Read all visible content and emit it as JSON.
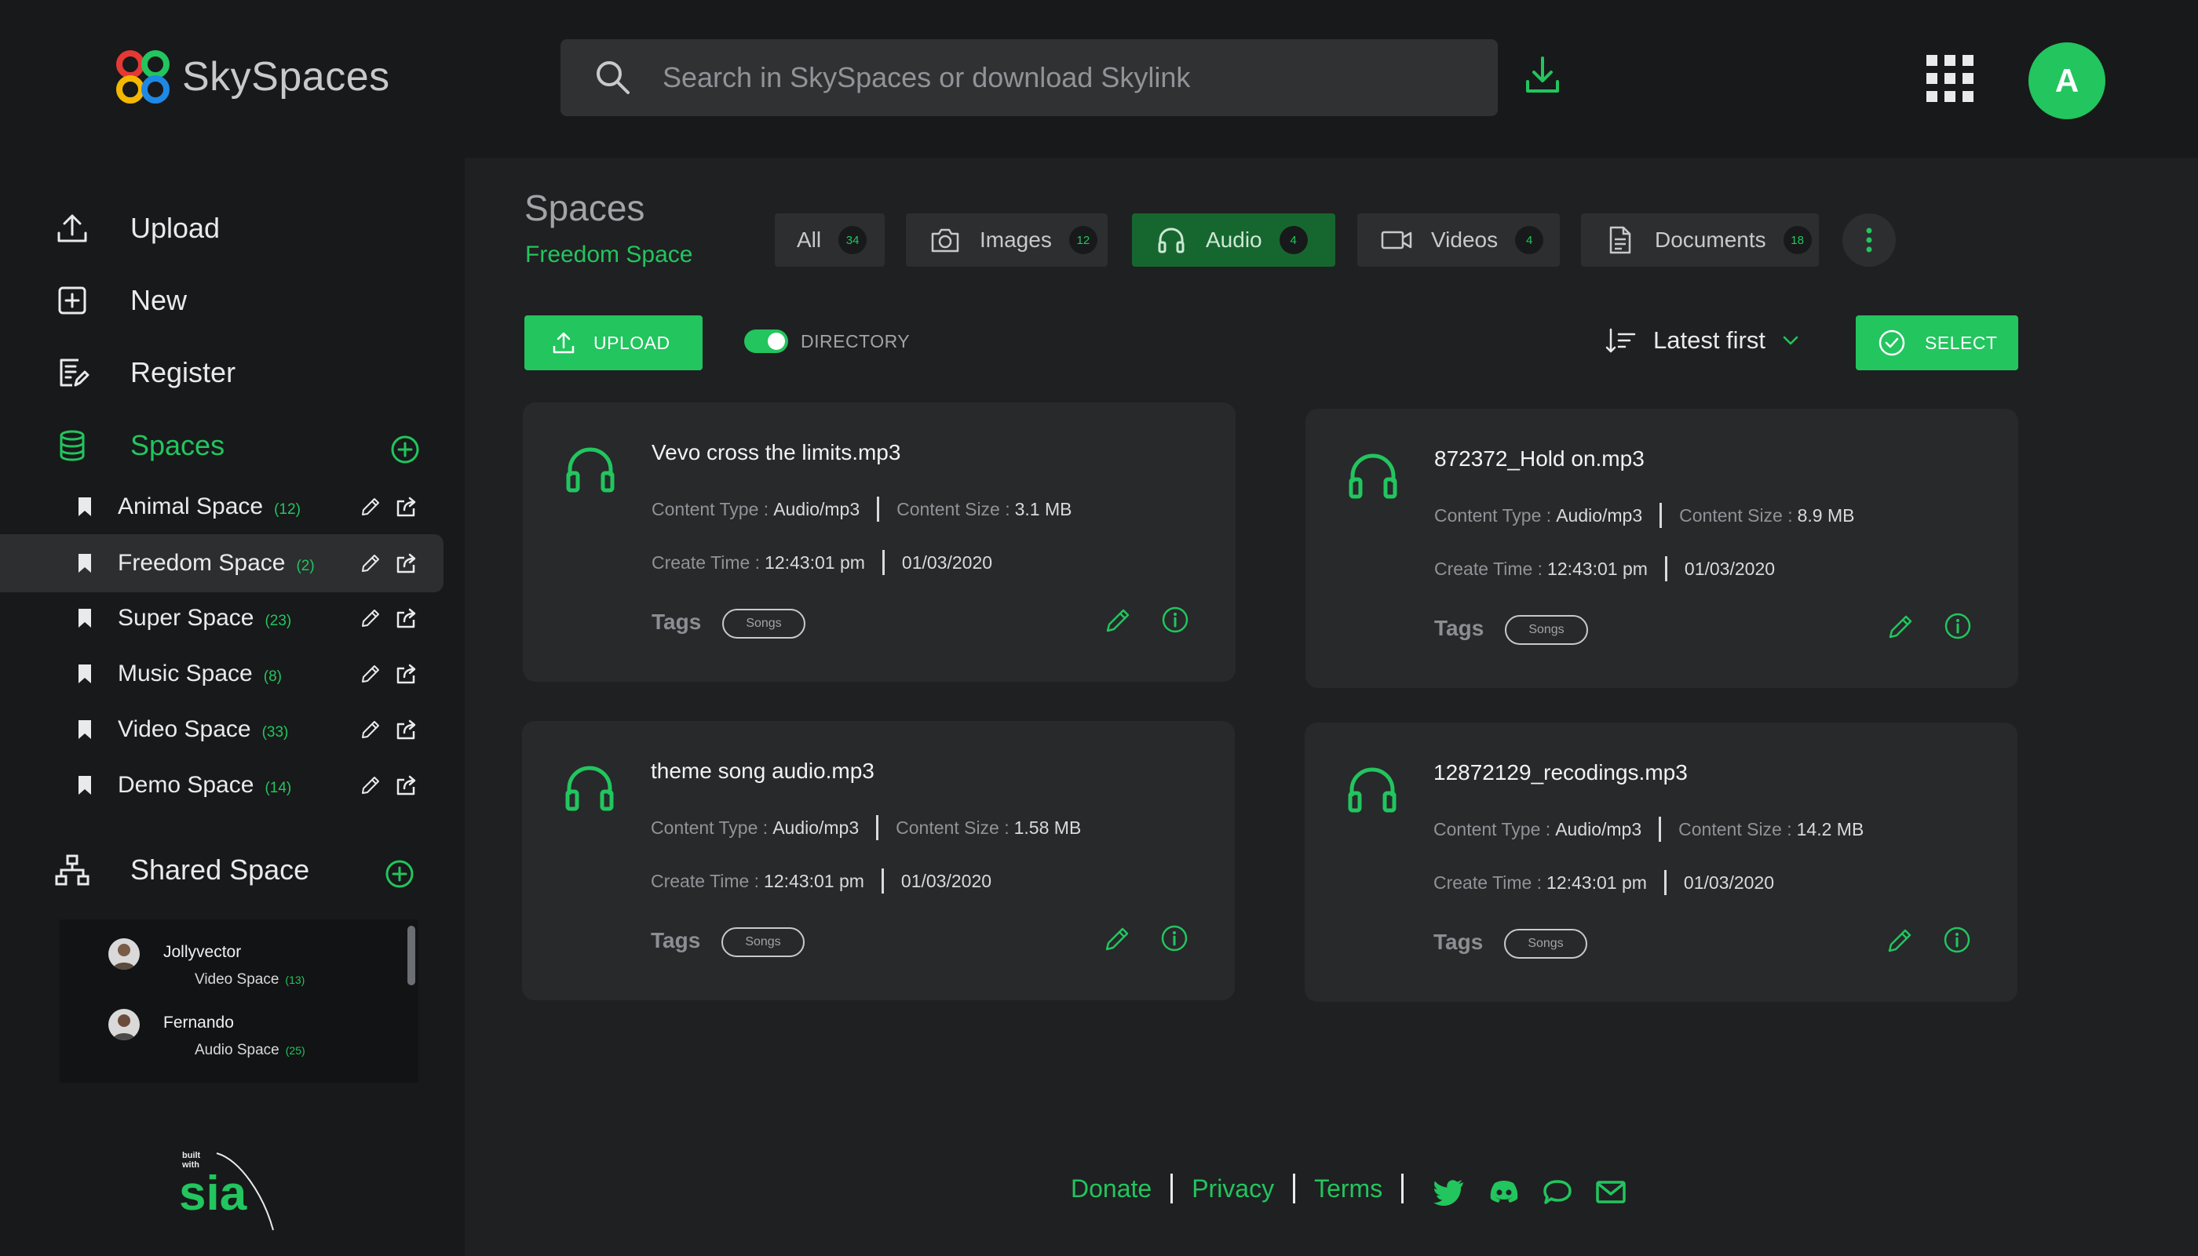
{
  "app": {
    "name": "SkySpaces",
    "avatar_letter": "A",
    "accent": "#22c55e"
  },
  "search": {
    "placeholder": "Search in SkySpaces or download Skylink"
  },
  "sidebar": {
    "nav": [
      {
        "label": "Upload",
        "icon": "upload-icon"
      },
      {
        "label": "New",
        "icon": "plus-square-icon"
      },
      {
        "label": "Register",
        "icon": "register-icon"
      },
      {
        "label": "Spaces",
        "icon": "database-icon"
      }
    ],
    "spaces": [
      {
        "name": "Animal Space",
        "count": "(12)"
      },
      {
        "name": "Freedom Space",
        "count": "(2)"
      },
      {
        "name": "Super Space",
        "count": "(23)"
      },
      {
        "name": "Music Space",
        "count": "(8)"
      },
      {
        "name": "Video Space",
        "count": "(33)"
      },
      {
        "name": "Demo Space",
        "count": "(14)"
      }
    ],
    "shared_title": "Shared Space",
    "shared": [
      {
        "user": "Jollyvector",
        "space": "Video Space",
        "count": "(13)"
      },
      {
        "user": "Fernando",
        "space": "Audio Space",
        "count": "(25)"
      }
    ],
    "built_with": {
      "line1": "built",
      "line2": "with",
      "brand": "sia"
    }
  },
  "main": {
    "title": "Spaces",
    "subtitle": "Freedom Space",
    "filters": [
      {
        "label": "All",
        "count": "34"
      },
      {
        "label": "Images",
        "count": "12"
      },
      {
        "label": "Audio",
        "count": "4"
      },
      {
        "label": "Videos",
        "count": "4"
      },
      {
        "label": "Documents",
        "count": "18"
      }
    ],
    "upload_label": "UPLOAD",
    "directory_label": "DIRECTORY",
    "sort_label": "Latest first",
    "select_label": "SELECT"
  },
  "labels": {
    "content_type": "Content Type :",
    "content_size": "Content Size :",
    "create_time": "Create Time :",
    "tags": "Tags"
  },
  "cards": [
    {
      "name": "Vevo cross the limits.mp3",
      "type": "Audio/mp3",
      "size": "3.1 MB",
      "time": "12:43:01 pm",
      "date": "01/03/2020",
      "tag": "Songs"
    },
    {
      "name": "872372_Hold on.mp3",
      "type": "Audio/mp3",
      "size": "8.9 MB",
      "time": "12:43:01 pm",
      "date": "01/03/2020",
      "tag": "Songs"
    },
    {
      "name": "theme song audio.mp3",
      "type": "Audio/mp3",
      "size": "1.58 MB",
      "time": "12:43:01 pm",
      "date": "01/03/2020",
      "tag": "Songs"
    },
    {
      "name": "12872129_recodings.mp3",
      "type": "Audio/mp3",
      "size": "14.2 MB",
      "time": "12:43:01 pm",
      "date": "01/03/2020",
      "tag": "Songs"
    }
  ],
  "footer": {
    "links": [
      "Donate",
      "Privacy",
      "Terms"
    ],
    "social": [
      "twitter-icon",
      "discord-icon",
      "chat-icon",
      "mail-icon"
    ]
  }
}
